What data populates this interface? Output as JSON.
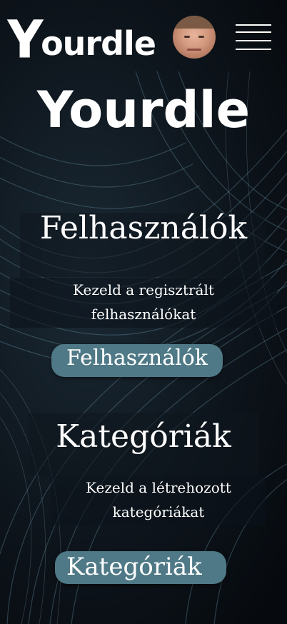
{
  "header": {
    "logo_text": "ourdle",
    "avatar_alt": "",
    "menu_icon": "hamburger-menu-icon"
  },
  "main": {
    "title": "Yourdle",
    "sections": [
      {
        "heading": "Felhasználók",
        "description_line1": "Kezeld a regisztrált",
        "description_line2": "felhasználókat",
        "button_label": "Felhasználók"
      },
      {
        "heading": "Kategóriák",
        "description_line1": "Kezeld a létrehozott",
        "description_line2": "kategóriákat",
        "button_label": "Kategóriák"
      }
    ]
  },
  "colors": {
    "button_bg": "#4f7986",
    "background": "#0a1016",
    "text": "#ffffff"
  }
}
